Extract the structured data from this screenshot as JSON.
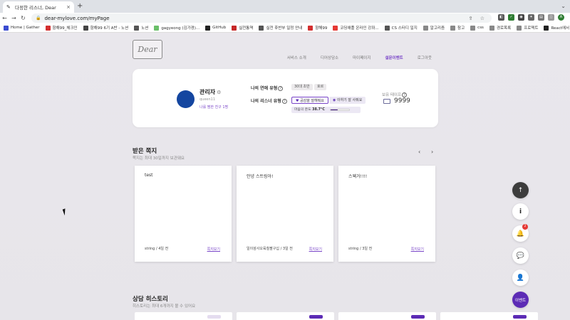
{
  "browser": {
    "tab_title": "다정한 리스너, Dear",
    "tab_icon": "quill-icon",
    "url": "dear-mylove.com/myPage",
    "new_tab": "+",
    "window_controls": "⌄",
    "url_actions": "⇪ ☆",
    "extensions": [
      "◧",
      "✓",
      "◉",
      "✦",
      "▤",
      "▯",
      "A"
    ]
  },
  "bookmarks": [
    {
      "label": "Home | Gather",
      "color": "#3b4cd0"
    },
    {
      "label": "항해99_체크인",
      "color": "#d32f2f"
    },
    {
      "label": "항해99 6기 A반 - 노션",
      "color": "#444444"
    },
    {
      "label": "노션",
      "color": "#555555"
    },
    {
      "label": "gagyeong (김가경)...",
      "color": "#6abf69"
    },
    {
      "label": "GitHub",
      "color": "#222222"
    },
    {
      "label": "실전통역",
      "color": "#c62828"
    },
    {
      "label": "실전 후반부 일정 안내",
      "color": "#555555"
    },
    {
      "label": "항해99",
      "color": "#d32f2f"
    },
    {
      "label": "코딩애플 온라인 강좌...",
      "color": "#e53935"
    },
    {
      "label": "CS 스터디 일지",
      "color": "#555555"
    },
    {
      "label": "알고리즘",
      "color": "#888888"
    },
    {
      "label": "참고",
      "color": "#888888"
    },
    {
      "label": "css",
      "color": "#888888"
    },
    {
      "label": "경로목록",
      "color": "#888888"
    },
    {
      "label": "프로젝트",
      "color": "#888888"
    },
    {
      "label": "React에서 FCM을...",
      "color": "#222222"
    }
  ],
  "site": {
    "logo_text": "Dear",
    "nav": [
      {
        "label": "서비스 소개",
        "active": false
      },
      {
        "label": "디어상담소",
        "active": false
      },
      {
        "label": "마이페이지",
        "active": false
      },
      {
        "label": "설문이벤트",
        "active": true
      },
      {
        "label": "로그아웃",
        "active": false
      }
    ]
  },
  "profile": {
    "name": "관리자",
    "settings_icon": "gear-icon",
    "user_id": "queen11",
    "friends": "나를 찜한 친구 1명",
    "avatar_color": "#1446a0",
    "love_type_label": "나의 연애 유형",
    "love_type_chips": [
      "30대 초반",
      "호르"
    ],
    "listener_type_label": "나의 리스너 유형",
    "listener_type_pills": [
      "공감을 잘해줘요",
      "이하기 잘 사줘요"
    ],
    "temperature_label": "마음의 온도",
    "temperature_value": "38.7°C",
    "temperature_fraction": 0.4,
    "tape_label": "보유 테이프",
    "tape_count": "9999"
  },
  "received": {
    "title": "받은 쪽지",
    "subtitle": "쪽지는 최대 30일까지 보관돼요",
    "prev": "‹",
    "next": "›",
    "notes": [
      {
        "text": "test",
        "meta": "string / 4일 전",
        "link": "쪽지보기"
      },
      {
        "text": "안녕 스트링아!",
        "meta": "일이삼사오육칠팔구십 / 3일 전",
        "link": "쪽지보기"
      },
      {
        "text": "스웩거!!!!",
        "meta": "string / 3일 전",
        "link": "쪽지보기"
      }
    ]
  },
  "history": {
    "title": "상담 히스토리",
    "subtitle": "히스토리는 최대 6개까지 볼 수 있어요",
    "badge_colors": [
      "#e4dcef",
      "#5c2bb5",
      "#5c2bb5",
      "#5c2bb5"
    ]
  },
  "fabs": {
    "top": "↑",
    "info": "i",
    "bell": "🔔",
    "notification_count": "2",
    "chat": "💬",
    "person": "👤",
    "event": "이벤트"
  }
}
